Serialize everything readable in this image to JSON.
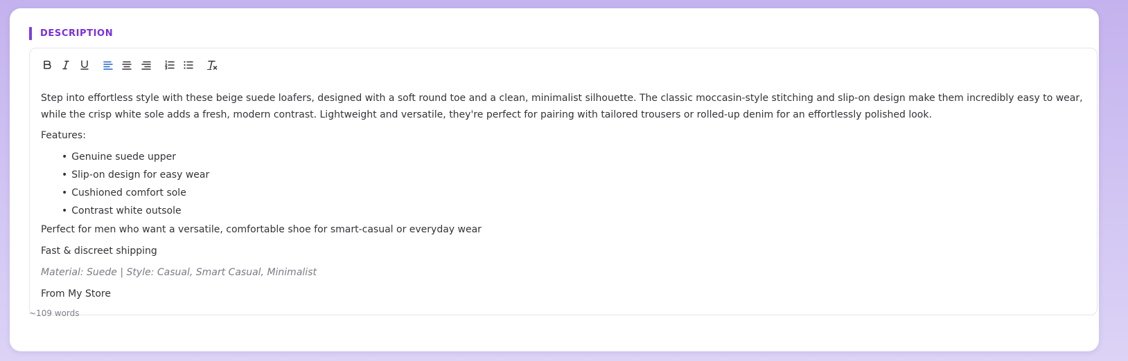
{
  "section": {
    "title": "DESCRIPTION"
  },
  "toolbar": {
    "buttons": [
      {
        "name": "bold-icon",
        "label": "B"
      },
      {
        "name": "italic-icon",
        "label": "I"
      },
      {
        "name": "underline-icon",
        "label": "U"
      },
      {
        "name": "align-left-icon",
        "label": "",
        "active": true
      },
      {
        "name": "align-center-icon",
        "label": ""
      },
      {
        "name": "align-right-icon",
        "label": ""
      },
      {
        "name": "ordered-list-icon",
        "label": ""
      },
      {
        "name": "bullet-list-icon",
        "label": ""
      },
      {
        "name": "clear-format-icon",
        "label": "T"
      }
    ],
    "active_color": "#1e63c8",
    "icon_color": "#333338"
  },
  "description": {
    "intro": "Step into effortless style with these beige suede loafers, designed with a soft round toe and a clean, minimalist silhouette. The classic moccasin-style stitching and slip-on design make them incredibly easy to wear, while the crisp white sole adds a fresh, modern contrast. Lightweight and versatile, they're perfect for pairing with tailored trousers or rolled-up denim for an effortlessly polished look.",
    "features_label": "Features:",
    "features": [
      "Genuine suede upper",
      "Slip-on design for easy wear",
      "Cushioned comfort sole",
      "Contrast white outsole"
    ],
    "audience": "Perfect for men who want a versatile, comfortable shoe for smart-casual or everyday wear",
    "shipping": "Fast & discreet shipping",
    "meta": "Material: Suede | Style: Casual, Smart Casual, Minimalist",
    "store": "From My Store"
  },
  "footer": {
    "word_count": "~109 words"
  },
  "colors": {
    "accent": "#7a3fe0",
    "title": "#7a2ee0",
    "background_gradient_top": "#c4b2ee",
    "background_gradient_bottom": "#dcd3f6"
  }
}
